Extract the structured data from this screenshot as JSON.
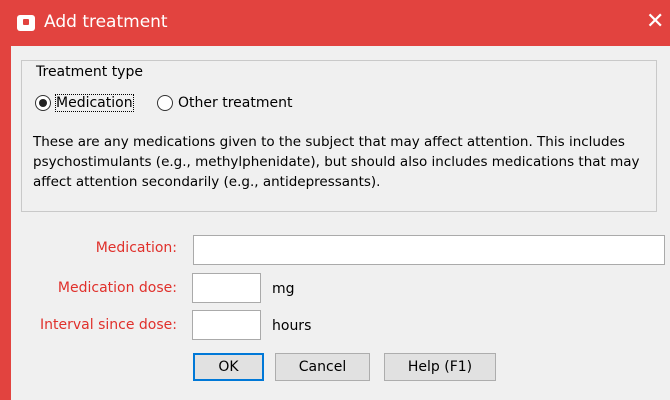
{
  "window": {
    "title": "Add treatment",
    "close_glyph": "✕",
    "app_icon": "dialog-app-icon"
  },
  "treatment_type": {
    "legend": "Treatment type",
    "options": [
      {
        "label": "Medication",
        "selected": true
      },
      {
        "label": "Other treatment",
        "selected": false
      }
    ],
    "description": "These are any medications given to the subject that may affect attention. This includes psychostimulants (e.g., methylphenidate), but should also includes medications that may affect attention secondarily (e.g., antidepressants)."
  },
  "form": {
    "medication_label": "Medication:",
    "medication_value": "",
    "dose_label": "Medication dose:",
    "dose_value": "",
    "dose_unit": "mg",
    "interval_label": "Interval since dose:",
    "interval_value": "",
    "interval_unit": "hours"
  },
  "buttons": {
    "ok": "OK",
    "cancel": "Cancel",
    "help": "Help (F1)"
  },
  "colors": {
    "title_bar": "#e2433f",
    "required_label": "#e0302b",
    "dialog_bg": "#f0f0f0"
  }
}
